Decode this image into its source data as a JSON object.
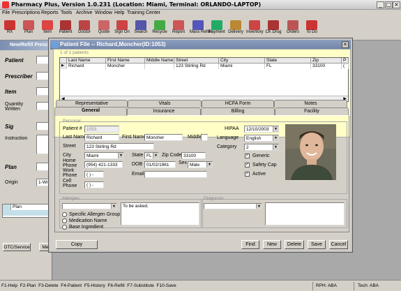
{
  "app": {
    "title": "Pharmacy Plus, Version 1.0.231 (Location: Miami, Terminal: ORLANDO-LAPTOP)"
  },
  "menu": [
    "File",
    "Prescriptions",
    "Reports",
    "Tools",
    "Archive",
    "Window",
    "Help",
    "Training Center"
  ],
  "toolbar": [
    {
      "label": "RX",
      "icon": "rx-icon",
      "color": "#c33"
    },
    {
      "label": "Plan",
      "icon": "plan-icon",
      "color": "#c55"
    },
    {
      "label": "Item",
      "icon": "item-icon",
      "color": "#d44"
    },
    {
      "label": "Patient",
      "icon": "patient-icon",
      "color": "#a33"
    },
    {
      "label": "Doctor",
      "icon": "doctor-icon",
      "color": "#b44"
    },
    {
      "label": "Quote",
      "icon": "quote-icon",
      "color": "#c66"
    },
    {
      "label": "Sign On",
      "icon": "sign-on-icon",
      "color": "#c44"
    },
    {
      "label": "Search",
      "icon": "search-icon",
      "color": "#55a"
    },
    {
      "label": "Recycle",
      "icon": "recycle-icon",
      "color": "#4a4"
    },
    {
      "label": "Report",
      "icon": "report-icon",
      "color": "#c55"
    },
    {
      "label": "Mass Refills",
      "icon": "mass-refills-icon",
      "color": "#55b"
    },
    {
      "label": "Payment",
      "icon": "payment-icon",
      "color": "#2a6"
    },
    {
      "label": "Delivery",
      "icon": "delivery-icon",
      "color": "#b83"
    },
    {
      "label": "Inventory",
      "icon": "inventory-icon",
      "color": "#c44"
    },
    {
      "label": "CK Drug",
      "icon": "ck-drug-icon",
      "color": "#a33"
    },
    {
      "label": "Orders",
      "icon": "orders-icon",
      "color": "#b55"
    },
    {
      "label": "To Do",
      "icon": "to-do-icon",
      "color": "#c33"
    }
  ],
  "new_prescription": {
    "title": "New/Refill Prescr...",
    "labels": {
      "patient": "Patient",
      "prescriber": "Prescriber",
      "item": "Item",
      "quantity": "Quantity Written",
      "sig": "Sig",
      "instruction": "Instruction",
      "plan": "Plan",
      "origin": "Origin"
    },
    "origin_value": "1-Writ",
    "plan_column": "Plan",
    "tabs": {
      "otc": "OTC/Service",
      "me": "Me"
    }
  },
  "patient_file": {
    "title": "Patient File -- Richard,Moncher(ID:1053)",
    "count": "1 of 1 patients",
    "grid_headers": [
      "Last Name",
      "First Name",
      "Middle Name",
      "Street",
      "City",
      "State",
      "Zip",
      "P"
    ],
    "grid_row": [
      "Richard",
      "Moncher",
      "",
      "123 Stirling Rd",
      "Miami",
      "FL",
      "33100",
      "("
    ],
    "tabs_back": [
      "Representative",
      "Vitals",
      "HCFA Form",
      "Notes"
    ],
    "tabs_front": [
      "General",
      "Insurance",
      "Billing",
      "Facility"
    ],
    "personal_legend": "Personal",
    "labels": {
      "patient_num": "Patient #",
      "last_name": "Last Name",
      "first_name": "First Name",
      "middle": "Middle",
      "street": "Street",
      "city": "City",
      "state": "State",
      "zip": "Zip Code",
      "home_phone": "Home Phone",
      "dob": "DOB",
      "sex": "Sex",
      "work_phone": "Work Phone",
      "email": "Email",
      "cell_phone": "Cell Phone",
      "hipaa": "HIPAA",
      "language": "Language",
      "category": "Category"
    },
    "values": {
      "patient_num": "1053",
      "last_name": "Richard",
      "first_name": "Moncher",
      "middle": "",
      "street": "123 Stirling Rd",
      "city": "Miami",
      "state": "FL",
      "zip": "33100",
      "home_phone": "(954) 421-1333",
      "dob": "01/02/1961",
      "sex": "Male",
      "work_phone": "(   )    -",
      "email": "",
      "cell_phone": "(   )    -",
      "hipaa": "12/10/2003",
      "language": "English",
      "category": "2"
    },
    "checks": {
      "generic": "Generic",
      "safety_cap": "Safety Cap",
      "active": "Active"
    },
    "allergies_legend": "Allergies",
    "allergy_options": [
      "Specific Allergen Group",
      "Medication Name",
      "Base Ingredient"
    ],
    "allergy_note": "To be asked.",
    "diagnosis_legend": "Diagnosis",
    "buttons": {
      "copy": "Copy",
      "find": "Find",
      "new": "New",
      "delete": "Delete",
      "save": "Save",
      "cancel": "Cancel"
    }
  },
  "statusbar": {
    "keys": "F1-Help  F2-Plan  F3-Delete  F4-Patient  F5-History  F6-Refill  F7-Substitute  F10-Save",
    "rph": "RPH: ABA",
    "tech": "Tech: ABA"
  }
}
